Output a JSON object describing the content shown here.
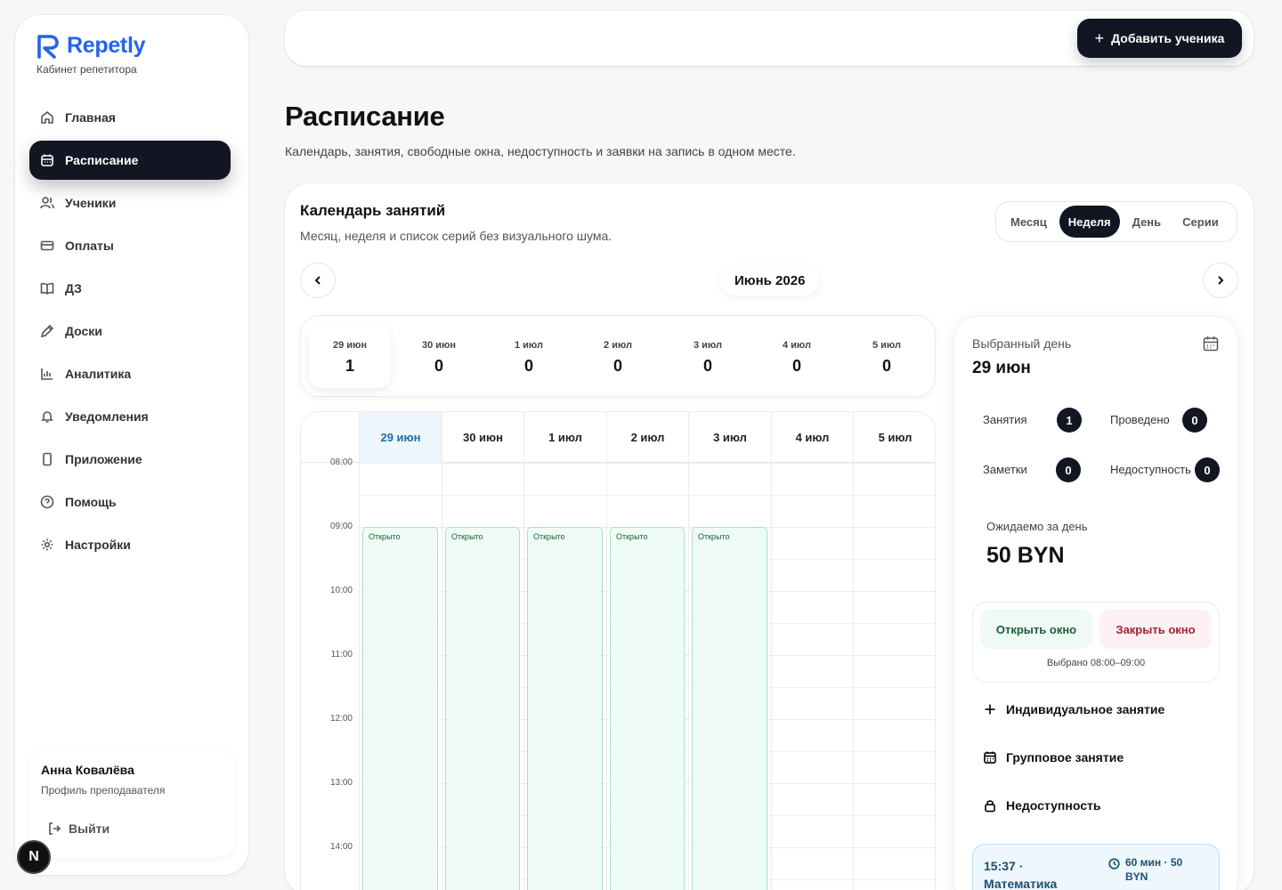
{
  "brand": {
    "name": "Repetly",
    "subtitle": "Кабинет репетитора",
    "accent": "#2563eb"
  },
  "sidebar": {
    "items": [
      {
        "label": "Главная",
        "icon": "home-icon"
      },
      {
        "label": "Расписание",
        "icon": "calendar-icon",
        "active": true
      },
      {
        "label": "Ученики",
        "icon": "user-icon"
      },
      {
        "label": "Оплаты",
        "icon": "card-icon"
      },
      {
        "label": "ДЗ",
        "icon": "book-icon"
      },
      {
        "label": "Доски",
        "icon": "pen-icon"
      },
      {
        "label": "Аналитика",
        "icon": "chart-icon"
      },
      {
        "label": "Уведомления",
        "icon": "bell-icon"
      },
      {
        "label": "Приложение",
        "icon": "phone-icon"
      },
      {
        "label": "Помощь",
        "icon": "help-icon"
      },
      {
        "label": "Настройки",
        "icon": "gear-icon"
      }
    ],
    "user": {
      "name": "Анна Ковалёва",
      "role": "Профиль преподавателя",
      "logout": "Выйти"
    },
    "badge": "N"
  },
  "topbar": {
    "add_student": "Добавить ученика"
  },
  "page": {
    "title": "Расписание",
    "subtitle": "Календарь, занятия, свободные окна, недоступность и заявки на запись в одном месте."
  },
  "calendar": {
    "title": "Календарь занятий",
    "subtitle": "Месяц, неделя и список серий без визуального шума.",
    "views": [
      "Месяц",
      "Неделя",
      "День",
      "Серии"
    ],
    "active_view": "Неделя",
    "month": "Июнь 2026",
    "week_strip": [
      {
        "date": "29 июн",
        "count": "1"
      },
      {
        "date": "30 июн",
        "count": "0"
      },
      {
        "date": "1 июл",
        "count": "0"
      },
      {
        "date": "2 июл",
        "count": "0"
      },
      {
        "date": "3 июл",
        "count": "0"
      },
      {
        "date": "4 июл",
        "count": "0"
      },
      {
        "date": "5 июл",
        "count": "0"
      }
    ],
    "columns": [
      "29 июн",
      "30 июн",
      "1 июл",
      "2 июл",
      "3 июл",
      "4 июл",
      "5 июл"
    ],
    "times": [
      "08:00",
      "09:00",
      "10:00",
      "11:00",
      "12:00",
      "13:00",
      "14:00"
    ],
    "open_label": "Открыто",
    "open_slots": [
      {
        "day": "29 июн",
        "start": "09:00"
      },
      {
        "day": "30 июн",
        "start": "09:00"
      },
      {
        "day": "1 июл",
        "start": "09:00"
      },
      {
        "day": "2 июл",
        "start": "09:00"
      },
      {
        "day": "3 июл",
        "start": "09:00"
      }
    ]
  },
  "day_panel": {
    "label": "Выбранный день",
    "date": "29 июн",
    "stats": {
      "lessons": {
        "label": "Занятия",
        "value": "1"
      },
      "done": {
        "label": "Проведено",
        "value": "0"
      },
      "notes": {
        "label": "Заметки",
        "value": "0"
      },
      "unavailable": {
        "label": "Недоступность",
        "value": "0"
      }
    },
    "expected_label": "Ожидаемо за день",
    "expected_value": "50 BYN",
    "open_window": "Открыть окно",
    "close_window": "Закрыть окно",
    "selected_range": "Выбрано 08:00–09:00",
    "actions": {
      "individual": "Индивидуальное занятие",
      "group": "Групповое занятие",
      "unavailable": "Недоступность"
    },
    "lesson": {
      "title": "15:37 · Математика",
      "meta": "60 мин · 50 BYN"
    }
  }
}
